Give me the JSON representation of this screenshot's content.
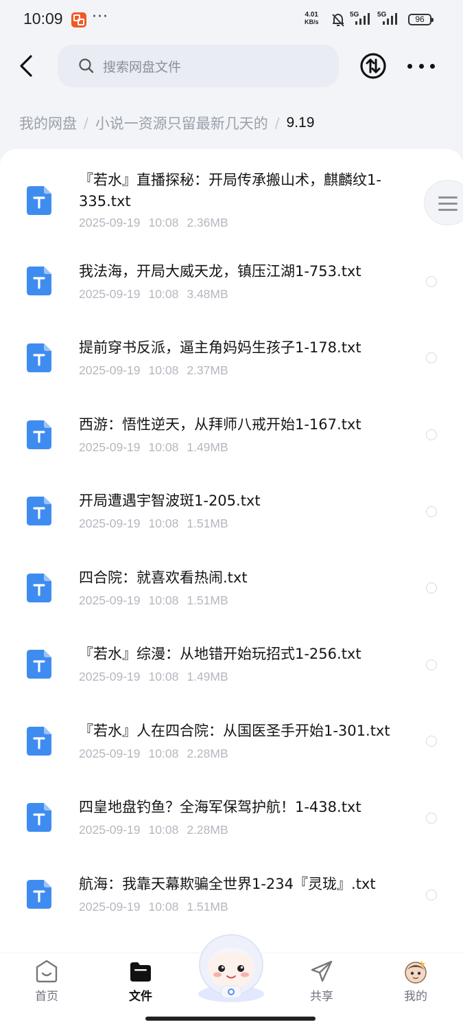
{
  "status_bar": {
    "time": "10:09",
    "speed_value": "4.01",
    "speed_unit": "KB/s",
    "net1": "5G",
    "net2": "5G",
    "battery": "96"
  },
  "header": {
    "search_placeholder": "搜索网盘文件"
  },
  "breadcrumb": {
    "items": [
      "我的网盘",
      "小说一资源只留最新几天的",
      "9.19"
    ]
  },
  "files": [
    {
      "name": "『若水』直播探秘：开局传承搬山术，麒麟纹1-335.txt",
      "date": "2025-09-19",
      "time": "10:08",
      "size": "2.36MB"
    },
    {
      "name": "我法海，开局大威天龙，镇压江湖1-753.txt",
      "date": "2025-09-19",
      "time": "10:08",
      "size": "3.48MB"
    },
    {
      "name": "提前穿书反派，逼主角妈妈生孩子1-178.txt",
      "date": "2025-09-19",
      "time": "10:08",
      "size": "2.37MB"
    },
    {
      "name": "西游：悟性逆天，从拜师八戒开始1-167.txt",
      "date": "2025-09-19",
      "time": "10:08",
      "size": "1.49MB"
    },
    {
      "name": "开局遭遇宇智波斑1-205.txt",
      "date": "2025-09-19",
      "time": "10:08",
      "size": "1.51MB"
    },
    {
      "name": "四合院：就喜欢看热闹.txt",
      "date": "2025-09-19",
      "time": "10:08",
      "size": "1.51MB"
    },
    {
      "name": "『若水』综漫：从地错开始玩招式1-256.txt",
      "date": "2025-09-19",
      "time": "10:08",
      "size": "1.49MB"
    },
    {
      "name": "『若水』人在四合院：从国医圣手开始1-301.txt",
      "date": "2025-09-19",
      "time": "10:08",
      "size": "2.28MB"
    },
    {
      "name": "四皇地盘钓鱼？全海军保驾护航！1-438.txt",
      "date": "2025-09-19",
      "time": "10:08",
      "size": "2.28MB"
    },
    {
      "name": "航海：我靠天幕欺骗全世界1-234『灵珑』.txt",
      "date": "2025-09-19",
      "time": "10:08",
      "size": "1.51MB"
    }
  ],
  "bottom_nav": {
    "home": "首页",
    "files": "文件",
    "share": "共享",
    "mine": "我的"
  },
  "colors": {
    "file_icon": "#3f8cf0",
    "active_tab": "#111111",
    "background": "#f2f4f8"
  }
}
